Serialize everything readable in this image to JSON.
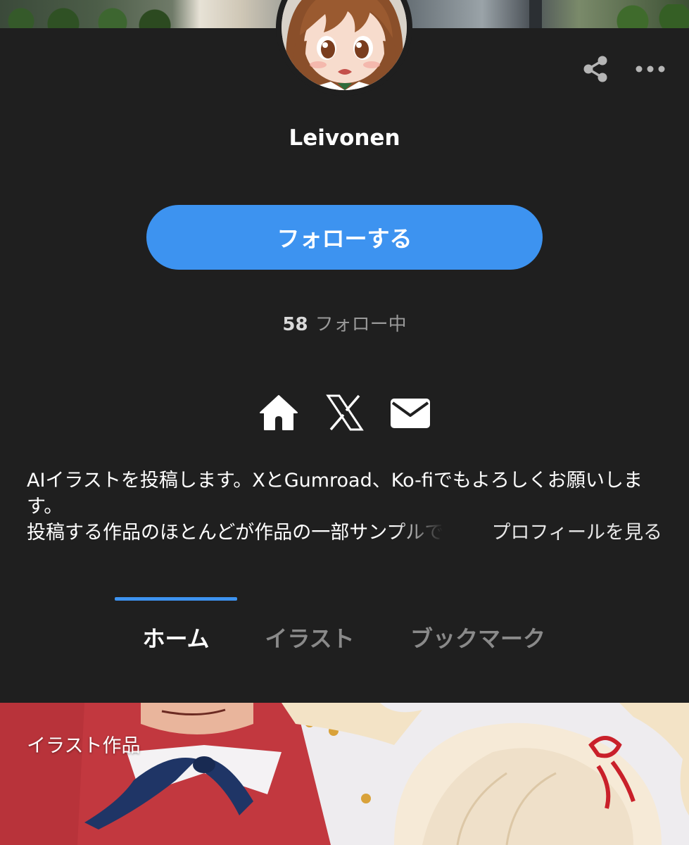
{
  "profile": {
    "name": "Leivonen",
    "follow_label": "フォローする",
    "following_count": "58",
    "following_label": "フォロー中"
  },
  "icons": {
    "share": "share-icon",
    "more": "more-horizontal-icon",
    "home": "home-icon",
    "x": "x-logo-icon",
    "mail": "mail-icon"
  },
  "bio": {
    "line1": "AIイラストを投稿します。XとGumroad、Ko-fiでもよろしくお願いしま",
    "line2": "す。",
    "line3": "投稿する作品のほとんどが作品の一部サンプルで",
    "see_profile": "プロフィールを見る"
  },
  "tabs": [
    {
      "label": "ホーム",
      "active": true
    },
    {
      "label": "イラスト",
      "active": false
    },
    {
      "label": "ブックマーク",
      "active": false
    }
  ],
  "section": {
    "label": "イラスト作品"
  },
  "colors": {
    "background": "#1f1f1f",
    "accent": "#3d93f0",
    "muted_text": "#8a8a8a"
  }
}
